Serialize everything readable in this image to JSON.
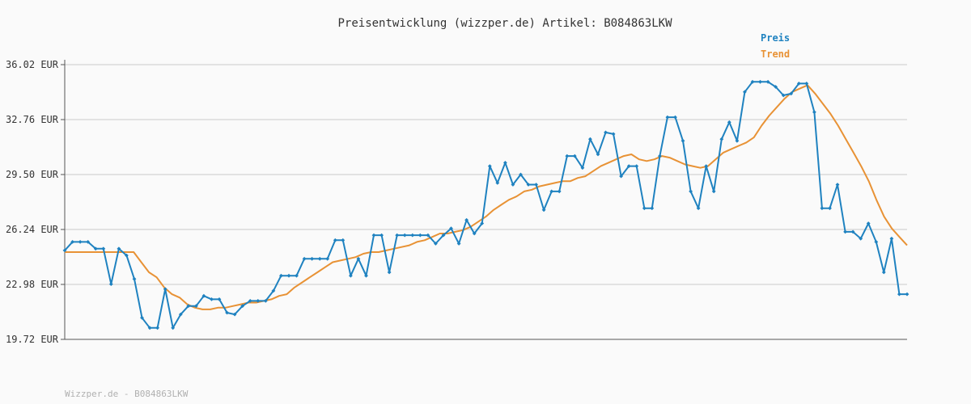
{
  "chart_data": {
    "type": "line",
    "title": "Preisentwicklung (wizzper.de) Artikel: B084863LKW",
    "xlabel": "",
    "ylabel": "",
    "ylim": [
      19.72,
      36.02
    ],
    "yticks": [
      19.72,
      22.98,
      26.24,
      29.5,
      32.76,
      36.02
    ],
    "ytick_labels": [
      "19.72 EUR",
      "22.98 EUR",
      "26.24 EUR",
      "29.50 EUR",
      "32.76 EUR",
      "36.02 EUR"
    ],
    "grid": true,
    "legend_position": "top-right",
    "series": [
      {
        "name": "Preis",
        "color": "#1f82c0",
        "markers": true,
        "values": [
          25.0,
          25.5,
          25.5,
          25.5,
          25.1,
          25.1,
          23.0,
          25.1,
          24.7,
          23.3,
          21.0,
          20.4,
          20.4,
          22.7,
          20.4,
          21.2,
          21.7,
          21.7,
          22.3,
          22.1,
          22.1,
          21.3,
          21.2,
          21.7,
          22.0,
          22.0,
          22.0,
          22.6,
          23.5,
          23.5,
          23.5,
          24.5,
          24.5,
          24.5,
          24.5,
          25.6,
          25.6,
          23.5,
          24.5,
          23.5,
          25.9,
          25.9,
          23.7,
          25.9,
          25.9,
          25.9,
          25.9,
          25.9,
          25.4,
          25.9,
          26.3,
          25.4,
          26.8,
          26.0,
          26.6,
          30.0,
          29.0,
          30.2,
          28.9,
          29.5,
          28.9,
          28.9,
          27.4,
          28.5,
          28.5,
          30.6,
          30.6,
          29.9,
          31.6,
          30.7,
          32.0,
          31.9,
          29.4,
          30.0,
          30.0,
          27.5,
          27.5,
          30.6,
          32.9,
          32.9,
          31.5,
          28.5,
          27.5,
          30.0,
          28.5,
          31.6,
          32.6,
          31.5,
          34.4,
          35.0,
          35.0,
          35.0,
          34.7,
          34.2,
          34.3,
          34.9,
          34.9,
          33.2,
          27.5,
          27.5,
          28.9,
          26.1,
          26.1,
          25.7,
          26.6,
          25.5,
          23.7,
          25.7,
          22.4,
          22.4
        ]
      },
      {
        "name": "Trend",
        "color": "#e89235",
        "markers": false,
        "values": [
          24.9,
          24.9,
          24.9,
          24.9,
          24.9,
          24.9,
          24.9,
          24.9,
          24.9,
          24.9,
          24.3,
          23.7,
          23.4,
          22.8,
          22.4,
          22.2,
          21.8,
          21.6,
          21.5,
          21.5,
          21.6,
          21.6,
          21.7,
          21.8,
          21.9,
          21.9,
          22.0,
          22.1,
          22.3,
          22.4,
          22.8,
          23.1,
          23.4,
          23.7,
          24.0,
          24.3,
          24.4,
          24.5,
          24.6,
          24.8,
          24.9,
          24.9,
          25.0,
          25.1,
          25.2,
          25.3,
          25.5,
          25.6,
          25.8,
          26.0,
          26.0,
          26.1,
          26.2,
          26.4,
          26.7,
          27.0,
          27.4,
          27.7,
          28.0,
          28.2,
          28.5,
          28.6,
          28.8,
          28.9,
          29.0,
          29.1,
          29.1,
          29.3,
          29.4,
          29.7,
          30.0,
          30.2,
          30.4,
          30.6,
          30.7,
          30.4,
          30.3,
          30.4,
          30.6,
          30.5,
          30.3,
          30.1,
          30.0,
          29.9,
          30.0,
          30.4,
          30.8,
          31.0,
          31.2,
          31.4,
          31.7,
          32.4,
          33.0,
          33.5,
          34.0,
          34.4,
          34.6,
          34.8,
          34.3,
          33.7,
          33.1,
          32.4,
          31.6,
          30.8,
          30.0,
          29.1,
          28.0,
          27.0,
          26.3,
          25.8,
          25.3
        ]
      }
    ]
  },
  "footer": {
    "text": "Wizzper.de - B084863LKW"
  }
}
